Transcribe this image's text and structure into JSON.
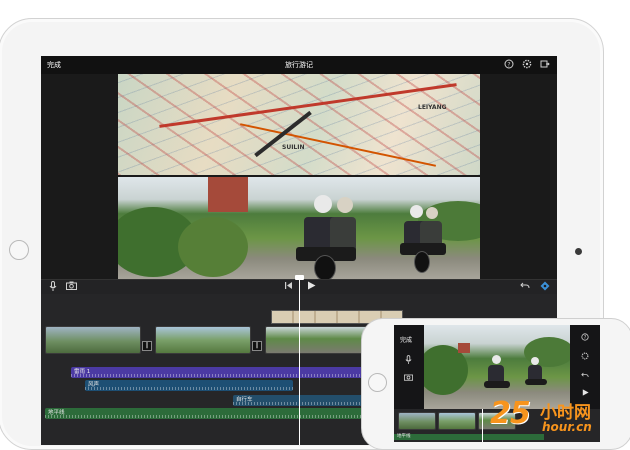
{
  "app": {
    "done_label": "完成",
    "project_title": "旅行游记",
    "icons": [
      "help-icon",
      "settings-icon",
      "export-icon",
      "microphone-icon",
      "camera-icon",
      "skip-back-icon",
      "play-icon",
      "undo-icon",
      "effects-icon"
    ]
  },
  "map_labels": [
    "SUILIN",
    "LEIYANG"
  ],
  "timeline": {
    "tracks": [
      {
        "label": "雷雨 1",
        "color": "#4b3aa3"
      },
      {
        "label": "风声",
        "color": "#1d4f74"
      },
      {
        "label": "自行车",
        "color": "#234e6b"
      },
      {
        "label": "地平线",
        "color": "#2c6b3a"
      }
    ],
    "transition_symbol": "‖"
  },
  "iphone": {
    "done_label": "完成",
    "track_label": "地平线"
  },
  "watermark": {
    "number": "25",
    "chinese": "小时网",
    "url": "hour.cn"
  },
  "colors": {
    "accent": "#3b8fd6",
    "watermark": "#f7941d"
  }
}
